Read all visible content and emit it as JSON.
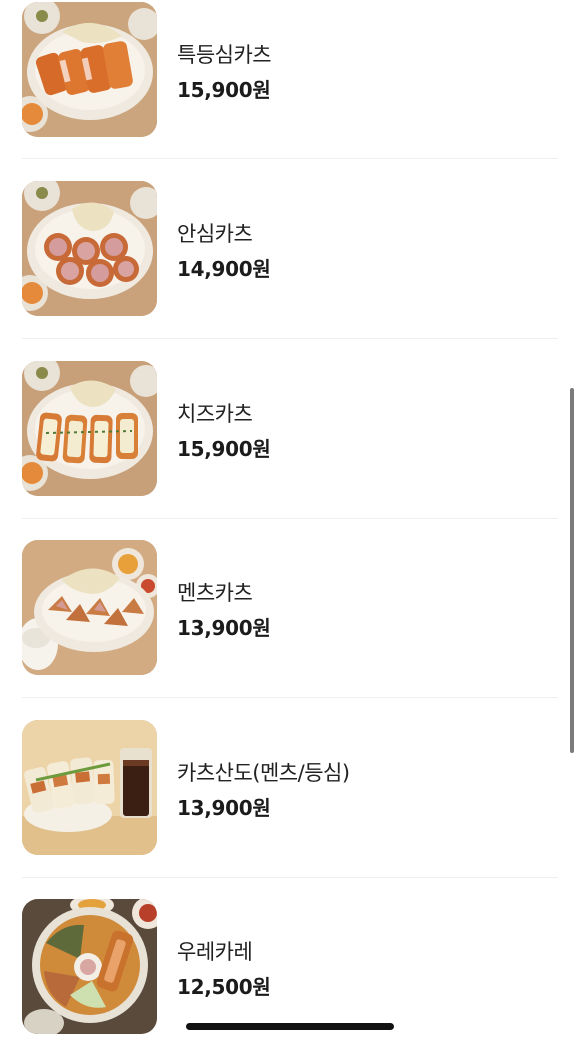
{
  "menu": {
    "items": [
      {
        "name": "특등심카츠",
        "price": "15,900원",
        "photo": "tokdeungsim-katsu-photo"
      },
      {
        "name": "안심카츠",
        "price": "14,900원",
        "photo": "ansim-katsu-photo"
      },
      {
        "name": "치즈카츠",
        "price": "15,900원",
        "photo": "cheese-katsu-photo"
      },
      {
        "name": "멘츠카츠",
        "price": "13,900원",
        "photo": "menchi-katsu-photo"
      },
      {
        "name": "카츠산도(멘츠/등심)",
        "price": "13,900원",
        "photo": "katsu-sando-photo"
      },
      {
        "name": "우레카레",
        "price": "12,500원",
        "photo": "ure-curry-photo"
      }
    ]
  },
  "colors": {
    "background": "#ffffff",
    "text": "#1b1b1b",
    "divider": "#efefef",
    "table_wood": "#c9a27a",
    "katsu_crust": "#d9742f"
  }
}
